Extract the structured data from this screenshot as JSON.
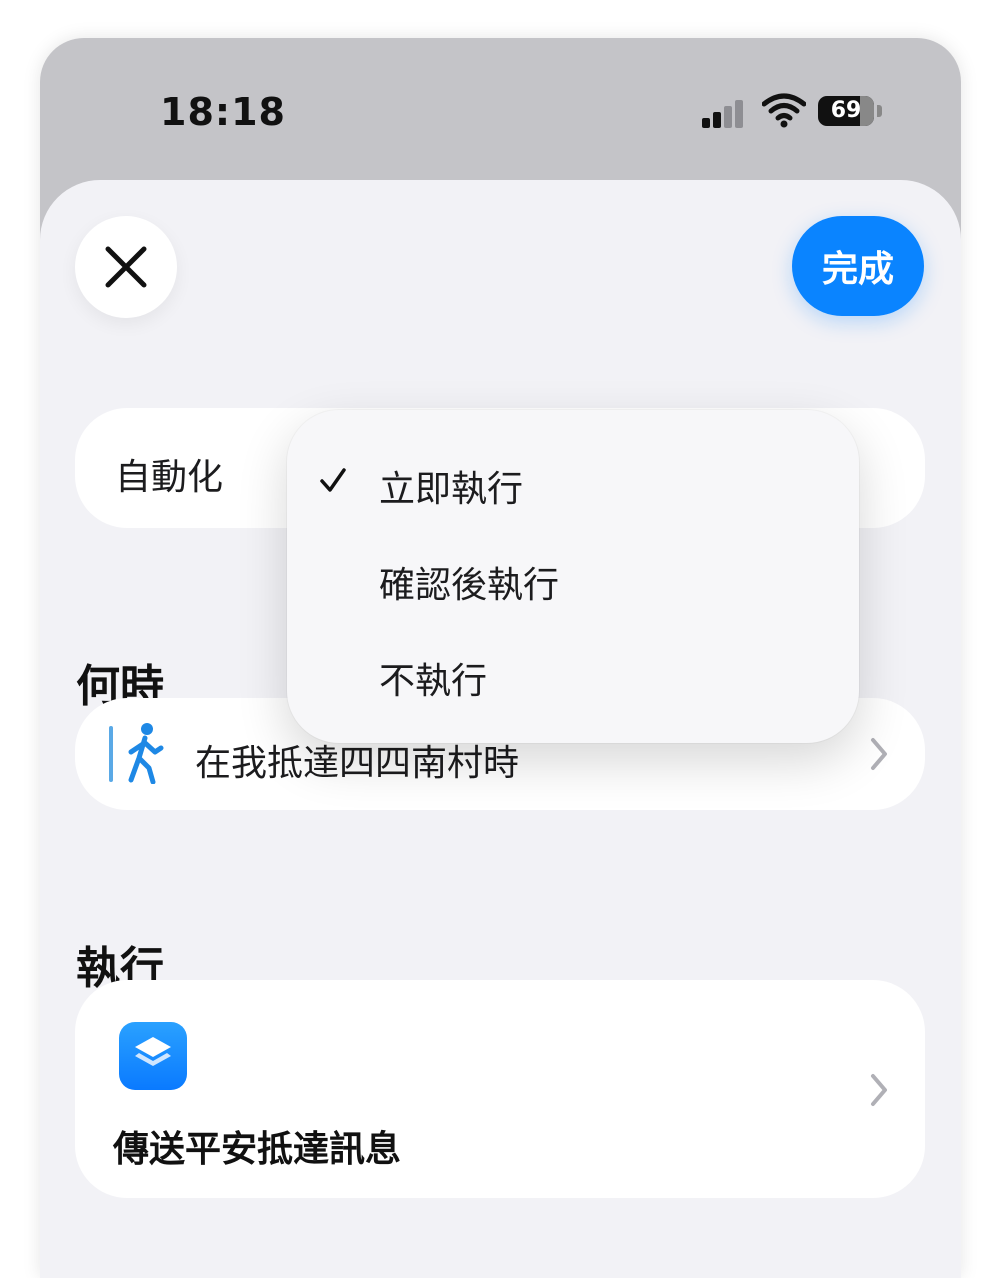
{
  "status_bar": {
    "time": "18:18",
    "battery": "69",
    "icons": [
      "cellular-signal-icon",
      "wifi-icon",
      "battery-icon"
    ]
  },
  "toolbar": {
    "close_icon": "close-icon",
    "done_label": "完成"
  },
  "automation": {
    "label": "自動化",
    "menu": {
      "items": [
        {
          "label": "立即執行",
          "checked": true
        },
        {
          "label": "確認後執行",
          "checked": false
        },
        {
          "label": "不執行",
          "checked": false
        }
      ]
    }
  },
  "when": {
    "heading": "何時",
    "trigger": "在我抵達四四南村時",
    "icon": "walking-person-icon"
  },
  "do": {
    "heading": "執行",
    "action": "傳送平安抵達訊息",
    "icon": "shortcuts-app-icon"
  },
  "colors": {
    "accent": "#0a84ff",
    "sheet": "#f2f2f6",
    "card": "#ffffff",
    "header_bg": "#c4c4c8"
  }
}
